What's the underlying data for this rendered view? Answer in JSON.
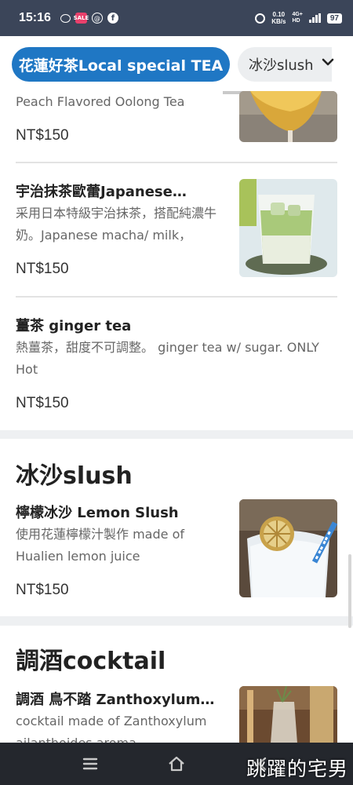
{
  "status_bar": {
    "time": "15:16",
    "speed_value": "0.10",
    "speed_unit": "KB/s",
    "network": "4G+",
    "network_sub": "HD",
    "battery": "97",
    "notification_icons": [
      "chat-bubble-icon",
      "sale-badge-icon",
      "threads-icon",
      "facebook-icon"
    ]
  },
  "tabs": {
    "active": "花蓮好茶Local special TEA",
    "next": "冰沙slush"
  },
  "items": [
    {
      "name": "",
      "desc": "Peach Flavored Oolong Tea",
      "price": "NT$150"
    },
    {
      "name": "宇治抹茶歐蕾Japanese…",
      "desc": "采用日本特級宇治抹茶，搭配純濃牛奶。Japanese macha/ milk，",
      "price": "NT$150"
    },
    {
      "name": "薑茶 ginger tea",
      "desc": "熱薑茶，甜度不可調整。 ginger tea w/ sugar. ONLY Hot",
      "price": "NT$150"
    },
    {
      "name": "檸檬冰沙 Lemon Slush",
      "desc": "使用花蓮檸檬汁製作 made of Hualien lemon juice",
      "price": "NT$150"
    },
    {
      "name": "調酒 鳥不踏 Zanthoxylum…",
      "desc": "cocktail made of Zanthoxylum ailanthoides aroma",
      "price": ""
    }
  ],
  "sections": {
    "slush": "冰沙slush",
    "cocktail": "調酒cocktail"
  },
  "watermark": "跳躍的宅男",
  "colors": {
    "accent": "#1f77c4",
    "status_bar": "#3b4559",
    "nav_bar": "#24272d"
  }
}
